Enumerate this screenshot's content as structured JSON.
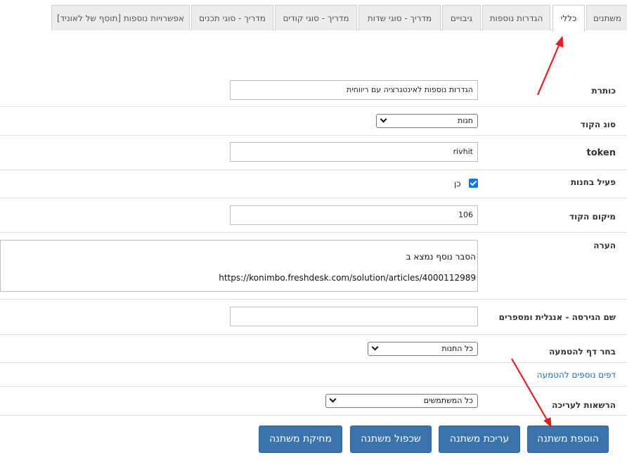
{
  "tabs": [
    {
      "label": "משתנים"
    },
    {
      "label": "כללי"
    },
    {
      "label": "הגדרות נוספות"
    },
    {
      "label": "גיבויים"
    },
    {
      "label": "מדריך - סוגי שדות"
    },
    {
      "label": "מדריך - סוגי קודים"
    },
    {
      "label": "מדריך - סוגי תכנים"
    },
    {
      "label": "אפשרויות נוספות [תוסף של לאוניד]"
    }
  ],
  "active_tab": "כללי",
  "form": {
    "title": {
      "label": "כותרת",
      "value": "הגדרות נוספות לאינטגרציה עם ריווחית"
    },
    "code_type": {
      "label": "סוג הקוד",
      "value": "חנות"
    },
    "token": {
      "label": "token",
      "value": "rivhit"
    },
    "active_in_store": {
      "label": "פעיל בחנות",
      "checked": true,
      "option_label": "כן"
    },
    "code_location": {
      "label": "מיקום הקוד",
      "value": "106"
    },
    "note": {
      "label": "הערה",
      "line1": "הסבר נוסף נמצא ב",
      "line2": "https://konimbo.freshdesk.com/solution/articles/4000112989"
    },
    "version_name": {
      "label": "שם הגירסה - אנגלית ומספרים",
      "value": ""
    },
    "embed_page": {
      "label": "בחר דף להטמעה",
      "value": "כל החנות"
    },
    "more_pages_link": "דפים נוספים להטמעה",
    "edit_permissions": {
      "label": "הרשאות לעריכה",
      "value": "כל המשתמשים"
    }
  },
  "buttons": {
    "add": "הוספת משתנה",
    "edit": "עריכת משתנה",
    "duplicate": "שכפול משתנה",
    "delete": "מחיקת משתנה"
  },
  "colors": {
    "button": "#3b74ad",
    "link": "#1e64b4",
    "annotation_arrow": "#e02020",
    "checkbox": "#0075ff"
  }
}
